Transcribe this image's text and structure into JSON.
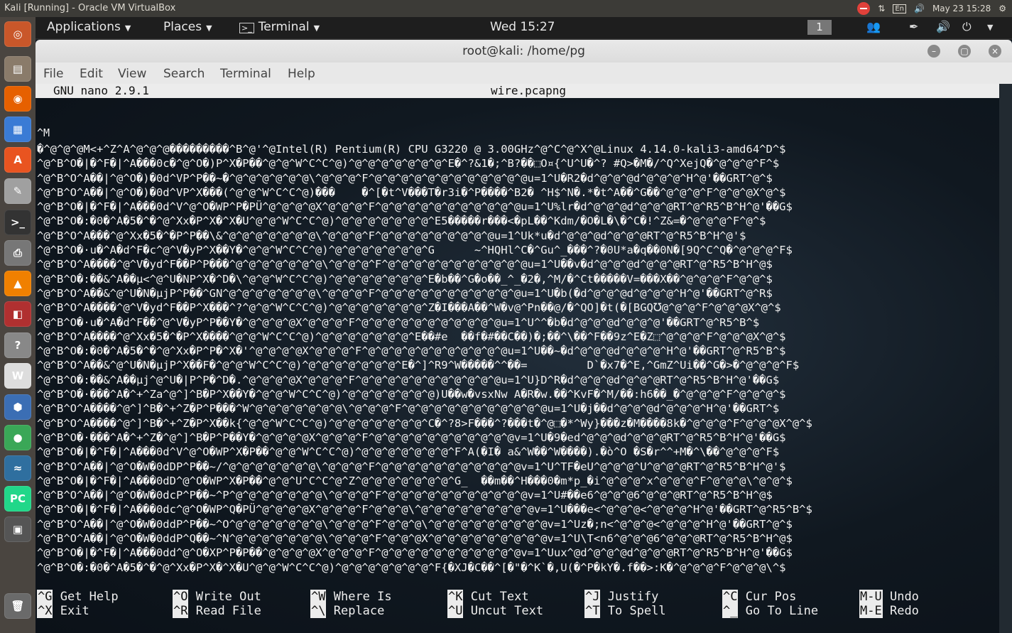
{
  "host": {
    "title": "Kali [Running] - Oracle VM VirtualBox",
    "tray_lang": "En",
    "clock": "May 23 15:28"
  },
  "launcher": {
    "icons": [
      {
        "name": "ubuntu-dash-icon",
        "glyph": "◎",
        "color": "#c9572a"
      },
      {
        "name": "files-icon",
        "glyph": "▤",
        "color": "#8a7b6a"
      },
      {
        "name": "firefox-icon",
        "glyph": "◉",
        "color": "#e66000"
      },
      {
        "name": "document-viewer-icon",
        "glyph": "▦",
        "color": "#3a7bd5"
      },
      {
        "name": "software-center-icon",
        "glyph": "A",
        "color": "#e95420"
      },
      {
        "name": "text-editor-icon",
        "glyph": "✎",
        "color": "#a0a0a0"
      },
      {
        "name": "terminal-icon",
        "glyph": ">_",
        "color": "#333333"
      },
      {
        "name": "printer-icon",
        "glyph": "⎙",
        "color": "#777777"
      },
      {
        "name": "vlc-icon",
        "glyph": "▲",
        "color": "#f08000"
      },
      {
        "name": "pdf-reader-icon",
        "glyph": "◧",
        "color": "#b03030"
      },
      {
        "name": "help-icon",
        "glyph": "?",
        "color": "#888888"
      },
      {
        "name": "writer-icon",
        "glyph": "W",
        "color": "#dddddd"
      },
      {
        "name": "virtualbox-icon",
        "glyph": "⬢",
        "color": "#3b6eb4"
      },
      {
        "name": "chrome-icon",
        "glyph": "●",
        "color": "#3aa757"
      },
      {
        "name": "system-monitor-icon",
        "glyph": "≈",
        "color": "#2f6f9f"
      },
      {
        "name": "pycharm-icon",
        "glyph": "PC",
        "color": "#21d789"
      },
      {
        "name": "video-editor-icon",
        "glyph": "▣",
        "color": "#555555"
      },
      {
        "name": "trash-icon",
        "glyph": "🗑",
        "color": "#6a6a6a"
      }
    ]
  },
  "panel": {
    "applications": "Applications",
    "places": "Places",
    "terminal": "Terminal",
    "clock": "Wed 15:27",
    "workspace": "1"
  },
  "window": {
    "title": "root@kali: /home/pg",
    "menu": [
      "File",
      "Edit",
      "View",
      "Search",
      "Terminal",
      "Help"
    ]
  },
  "nano": {
    "version": "GNU nano 2.9.1",
    "filename": "wire.pcapng",
    "prev_line": "^M",
    "lines": [
      "�^@^@^@M<+^Z^A^@^@^@���������^B^@'^@Intel(R) Pentium(R) CPU G3220 @ 3.00GHz^@^C^@^X^@Linux 4.14.0-kali3-amd64^D^$",
      "^@^B^O�|�^F�|^A���0c�^@^O�)P^X�P��^@^@^W^C^C^@)^@^@^@^@^@^@^@^E�^?&1�;^B?��⬚O¤{^U^U�^? #Q>�M�/^Q^XejQ�^@^@^@^F^$",
      "^@^B^O^A��|^@^O�)�0d^VP^P��~�^@^@^@^@^@^@\\^@^@^@^F^@^@^@^@^@^@^@^@^@^@^@^@u=1^U�R2�d^@^@^@d^@^@^@^H^@'��GRT^@^$",
      "^@^B^O^A��|^@^O�)�0d^VP^X���(^@^@^W^C^C^@)���    �^[�t^V���T�r3i�^P����^B2� ^H$^N�.*�t^A��^G��^@^@^@^F^@^@^@X^@^$",
      "^@^B^O�|�^F�|^A���0d^V^@^O�WP^P�PÜ^@^@^@^@X^@^@^@^F^@^@^@^@^@^@^@^@^@^@^@u=1^U%lr�d^@^@^@d^@^@^@RT^@^R5^B^H^@'��G$",
      "^@^B^O�:�0�^A�5�^�^@^Xx�P^X�^X�U^@^@^W^C^C^@)^@^@^@^@^@^@^@^E5�����r���<�pL��^Kdm/�O�L�\\�^C�!^Z&=�^@^@^@^F^@^$",
      "^@^B^O^A���^@^Xx�5�^�P^P��\\&^@^@^@^@^@^@^@\\^@^@^@^F^@^@^@^@^@^@^@^@^@u=1^Uk*u�d^@^@^@d^@^@^@RT^@^R5^B^H^@'$",
      "^@^B^O�·u�^A�d^F�c^@^V�yP^X��Y�^@^@^W^C^C^@)^@^@^@^@^@^@^@^G      ~^HQHl^C�^Gu^_���^?�0U*a�q��0N�[9Q^C^Q�^@^@^@^F$",
      "^@^B^O^A����^@^V�yd^F��P^P���^@^@^@^@^@^@^@\\^@^@^@^F^@^@^@^@^@^@^@^@^@^@^@u=1^U��v�d^@^@^@d^@^@^@RT^@^R5^B^H^@$",
      "^@^B^O�:��&^A��µ<^@^U�NP^X�^D�\\^@^@^W^C^C^@)^@^@^@^@^@^@^@^E�b��^G�o��_^_�2�,^M/�^Ct�����V=���X��^@^@^@^F^@^@^$",
      "^@^B^O^A��&^@^U�N�µjP^P��^GN^@^@^@^@^@^@^@\\^@^@^@^F^@^@^@^@^@^@^@^@^@^@^@u=1^U�b(�d^@^@^@d^@^@^@^H^@'��GRT^@^R$",
      "^@^B^O^A����^@^V�yd^F��P^X���^?^@^@^W^C^C^@)^@^@^@^@^@^@^@^Z�I���A��^W�v@^Pn��@/�^QO]�t(�[BGQ℧@^@^@^F^@^@^@X^@^$",
      "^@^B^O�·u�^A�d^F��^@^V�yP^P��Y�^@^@^@^@X^@^@^@^F^@^@^@^@^@^@^@^@^@^@^@u=1^U^^�b�d^@^@^@d^@^@^@'��GRT^@^R5^B^$",
      "^@^B^O^A����^@^Xx�5�^�P^X����^@^@^W^C^C^@)^@^@^@^@^@^@^@^E��#e  ��f�#��C��)�;��^\\��^F��9z^E�Z⬚^@^@^@^F^@^@^@X^@^$",
      "^@^B^O�:�0�^A�5�^�^@^Xx�P^P�^X�'^@^@^@^@X^@^@^@^F^@^@^@^@^@^@^@^@^@^@^@u=1^U��~�d^@^@^@d^@^@^@^H^@'��GRT^@^R5^B^$",
      "^@^B^O^A��&^@^U�N�µjP^X��F�^@^@^W^C^C^@)^@^@^@^@^@^@^@^E�^]^R9^W�����^^��=         D`�x7�^E,^GmZ^Ui��^G�>�^@^@^@^F$",
      "^@^B^O�:��&^A��µj^@^U�|P^P�^D�.^@^@^@^@X^@^@^@^F^@^@^@^@^@^@^@^@^@^@^@u=1^U}D^R�d^@^@^@d^@^@^@RT^@^R5^B^H^@'��G$",
      "^@^B^O�·���^A�^+^Za^@^]^B�P^X��Y�^@^@^W^C^C^@)^@^@^@^@^@^@^@)U��w�vsxNw A�R�w.��^KvF�^M/��:h6��_�^@^@^@^F^@^@^@^$",
      "^@^B^O^A����^@^]^B�^+^Z�P^P���^W^@^@^@^@^@^@^@\\^@^@^@^F^@^@^@^@^@^@^@^@^@^@^@u=1^U�j��d^@^@^@d^@^@^@^H^@'��GRT^$",
      "^@^B^O^A����^@^]^B�^+^Z�P^X��k{^@^@^W^C^C^@)^@^@^@^@^@^@^@^C�^?8>F���^?���t�^@⬚�*^Wy}���z�M����8k�^@^@^@^F^@^@^@X^@^$",
      "^@^B^O�·���^A�^+^Z�^@^]^B�P^P��Y�^@^@^@^@X^@^@^@^F^@^@^@^@^@^@^@^@^@^@^@v=1^U�9�ed^@^@^@d^@^@^@RT^@^R5^B^H^@'��G$",
      "^@^B^O�|�^F�|^A���0d^V^@^O�WP^X�P��^@^@^W^C^C^@)^@^@^@^@^@^@^@^F^A(�I� a&^W��^W����).�ò^O �S�r^^+M�^\\��^@^@^@^F$",
      "^@^B^O^A��|^@^O�W�0dDP^P��~/^@^@^@^@^@^@^@\\^@^@^@^F^@^@^@^@^@^@^@^@^@^@^@v=1^U^TF�eU^@^@^@^U^@^@^@RT^@^R5^B^H^@'$",
      "^@^B^O�|�^F�|^A���0dD^@^O�WP^X�P��^@^@^U^C^C^@^Z^@^@^@^@^@^@^@^G_  ��m��^H���0�m*p_�i^@^@^@^x^@^@^@^F^@^@^@\\^@^@^$",
      "^@^B^O^A��|^@^O�W�0dcP^P��~^P^@^@^@^@^@^@^@\\^@^@^@^F^@^@^@^@^@^@^@^@^@^@^@v=1^U#��e6^@^@^@6^@^@^@RT^@^R5^B^H^@$",
      "^@^B^O�|�^F�|^A���0dc^@^O�WP^Q�PÜ^@^@^@^@X^@^@^@^F^@^@^@\\^@^@^@^@^@^@^@^@^@v=1^U���e<^@^@^@<^@^@^@^H^@'��GRT^@^R5^B^$",
      "^@^B^O^A��|^@^O�W�0ddP^P��~^O^@^@^@^@^@^@^@\\^@^@^@^F^@^@^@\\^@^@^@^@^@^@^@^@^@v=1^Uz�;n<^@^@^@<^@^@^@^H^@'��GRT^@^$",
      "^@^B^O^A��|^@^O�W�0ddP^Q��~^N^@^@^@^@^@^@^@\\^@^@^@^F^@^@^@X^@^@^@^@^@^@^@^@^@v=1^U\\T<n6^@^@^@6^@^@^@RT^@^R5^B^H^@$",
      "^@^B^O�|�^F�|^A���0dd^@^O�XP^P�P��^@^@^@^@X^@^@^@^F^@^@^@^@^@^@^@^@^@^@^@v=1^Uux^@d^@^@^@d^@^@^@RT^@^R5^B^H^@'��G$",
      "^@^B^O�:�0�^A�5�^�^@^Xx�P^X�^X�U^@^@^W^C^C^@)^@^@^@^@^@^@^@^F{�XJ�C��^[�\"�^K`�,U(�^P�kY�.f��>:K�^@^@^@^F^@^@^@\\^$"
    ],
    "shortcuts": [
      {
        "key1": "^G",
        "label1": "Get Help",
        "key2": "^X",
        "label2": "Exit"
      },
      {
        "key1": "^O",
        "label1": "Write Out",
        "key2": "^R",
        "label2": "Read File"
      },
      {
        "key1": "^W",
        "label1": "Where Is",
        "key2": "^\\",
        "label2": "Replace"
      },
      {
        "key1": "^K",
        "label1": "Cut Text",
        "key2": "^U",
        "label2": "Uncut Text"
      },
      {
        "key1": "^J",
        "label1": "Justify",
        "key2": "^T",
        "label2": "To Spell"
      },
      {
        "key1": "^C",
        "label1": "Cur Pos",
        "key2": "^_",
        "label2": "Go To Line"
      },
      {
        "key1": "M-U",
        "label1": "Undo",
        "key2": "M-E",
        "label2": "Redo"
      }
    ]
  }
}
